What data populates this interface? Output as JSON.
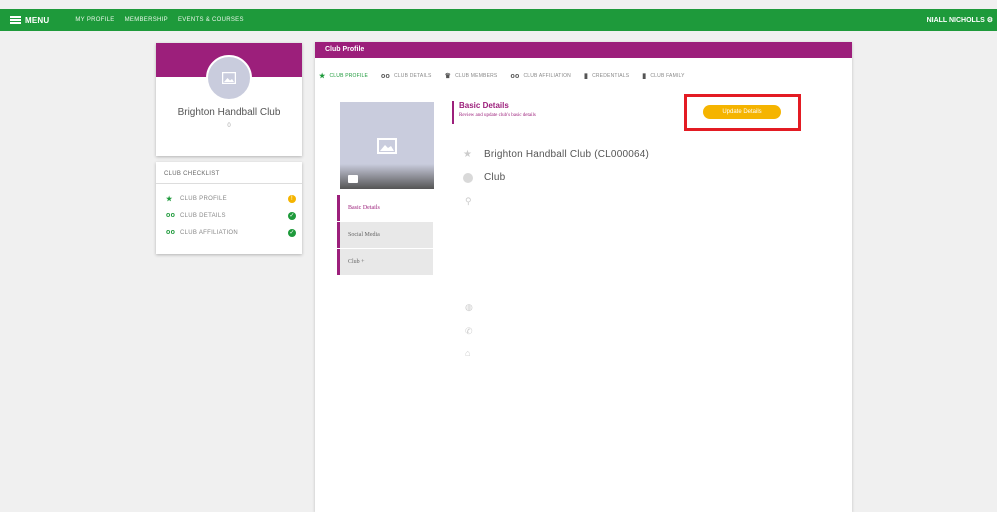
{
  "topbar": {
    "menu_label": "MENU",
    "nav": [
      "MY PROFILE",
      "MEMBERSHIP",
      "EVENTS & COURSES"
    ],
    "user": "NIALL NICHOLLS ⚙"
  },
  "profile_card": {
    "club_name": "Brighton Handball Club",
    "sub": "0"
  },
  "checklist": {
    "title": "CLUB CHECKLIST",
    "items": [
      {
        "label": "CLUB PROFILE",
        "icon": "★",
        "status_color": "#f5b400",
        "status_glyph": "!"
      },
      {
        "label": "CLUB DETAILS",
        "icon": "oo",
        "status_color": "#1e9a3b",
        "status_glyph": "✓"
      },
      {
        "label": "CLUB AFFILIATION",
        "icon": "oo",
        "status_color": "#1e9a3b",
        "status_glyph": "✓"
      }
    ]
  },
  "main": {
    "header": "Club Profile",
    "tabs": [
      {
        "icon": "★",
        "label": "CLUB PROFILE"
      },
      {
        "icon": "oo",
        "label": "CLUB DETAILS"
      },
      {
        "icon": "♛",
        "label": "CLUB MEMBERS"
      },
      {
        "icon": "oo",
        "label": "CLUB AFFILIATION"
      },
      {
        "icon": "▮",
        "label": "CREDENTIALS"
      },
      {
        "icon": "▮",
        "label": "CLUB FAMILY"
      }
    ],
    "side_tabs": [
      "Basic Details",
      "Social Media",
      "Club +"
    ],
    "section_title": "Basic Details",
    "section_desc": "Review and update club's basic details",
    "update_button": "Update Details",
    "club_full_name": "Brighton Handball Club (CL000064)",
    "club_type": "Club"
  },
  "colors": {
    "brand_green": "#1e9a3b",
    "brand_purple": "#9c1f7b",
    "accent_yellow": "#f5b400",
    "highlight_red": "#e31b23"
  }
}
